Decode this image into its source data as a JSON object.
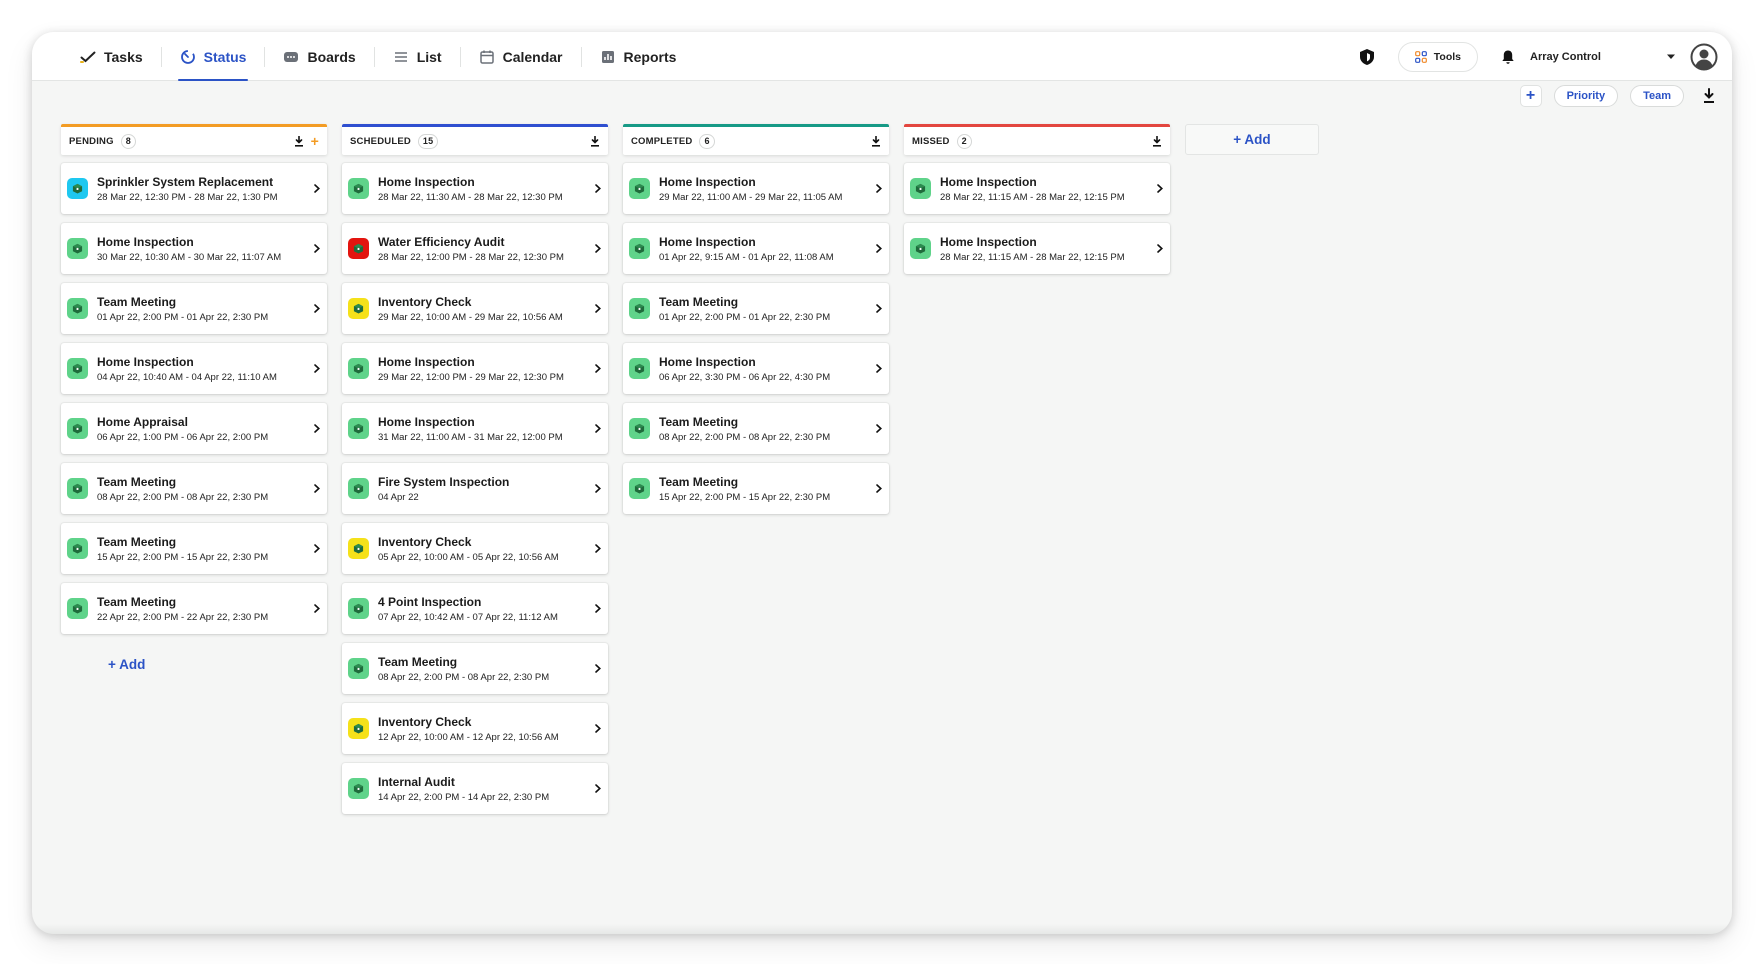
{
  "nav": {
    "tabs": [
      {
        "label": "Tasks",
        "icon": "check-icon"
      },
      {
        "label": "Status",
        "icon": "status-icon",
        "active": true
      },
      {
        "label": "Boards",
        "icon": "boards-icon"
      },
      {
        "label": "List",
        "icon": "list-icon"
      },
      {
        "label": "Calendar",
        "icon": "calendar-icon"
      },
      {
        "label": "Reports",
        "icon": "reports-icon"
      }
    ]
  },
  "toolbar": {
    "tools_label": "Tools",
    "account_name": "Array Control"
  },
  "filters": {
    "priority_label": "Priority",
    "team_label": "Team"
  },
  "colors": {
    "accent": "#2b53c6",
    "pending": "#f39c24",
    "scheduled": "#2f4fd0",
    "completed": "#179a86",
    "missed": "#e3463f",
    "icon_green": "#5fd38a",
    "icon_yellow": "#f5e11a",
    "icon_red": "#e3150f",
    "icon_cyan": "#1ec8f0"
  },
  "columns": [
    {
      "title": "PENDING",
      "count": "8",
      "color": "#f39c24",
      "has_plus": true,
      "add_label": "+ Add",
      "cards": [
        {
          "title": "Sprinkler System Replacement",
          "date": "28 Mar 22, 12:30 PM - 28 Mar 22, 1:30 PM",
          "icon_color": "#1ec8f0"
        },
        {
          "title": "Home Inspection",
          "date": "30 Mar 22, 10:30 AM - 30 Mar 22, 11:07 AM",
          "icon_color": "#5fd38a"
        },
        {
          "title": "Team Meeting",
          "date": "01 Apr 22, 2:00 PM - 01 Apr 22, 2:30 PM",
          "icon_color": "#5fd38a"
        },
        {
          "title": "Home Inspection",
          "date": "04 Apr 22, 10:40 AM - 04 Apr 22, 11:10 AM",
          "icon_color": "#5fd38a"
        },
        {
          "title": "Home Appraisal",
          "date": "06 Apr 22, 1:00 PM - 06 Apr 22, 2:00 PM",
          "icon_color": "#5fd38a"
        },
        {
          "title": "Team Meeting",
          "date": "08 Apr 22, 2:00 PM - 08 Apr 22, 2:30 PM",
          "icon_color": "#5fd38a"
        },
        {
          "title": "Team Meeting",
          "date": "15 Apr 22, 2:00 PM - 15 Apr 22, 2:30 PM",
          "icon_color": "#5fd38a"
        },
        {
          "title": "Team Meeting",
          "date": "22 Apr 22, 2:00 PM - 22 Apr 22, 2:30 PM",
          "icon_color": "#5fd38a"
        }
      ]
    },
    {
      "title": "SCHEDULED",
      "count": "15",
      "color": "#2f4fd0",
      "has_plus": false,
      "cards": [
        {
          "title": "Home Inspection",
          "date": "28 Mar 22, 11:30 AM - 28 Mar 22, 12:30 PM",
          "icon_color": "#5fd38a"
        },
        {
          "title": "Water Efficiency Audit",
          "date": "28 Mar 22, 12:00 PM - 28 Mar 22, 12:30 PM",
          "icon_color": "#e3150f"
        },
        {
          "title": "Inventory Check",
          "date": "29 Mar 22, 10:00 AM - 29 Mar 22, 10:56 AM",
          "icon_color": "#f5e11a"
        },
        {
          "title": "Home Inspection",
          "date": "29 Mar 22, 12:00 PM - 29 Mar 22, 12:30 PM",
          "icon_color": "#5fd38a"
        },
        {
          "title": "Home Inspection",
          "date": "31 Mar 22, 11:00 AM - 31 Mar 22, 12:00 PM",
          "icon_color": "#5fd38a"
        },
        {
          "title": "Fire System Inspection",
          "date": "04 Apr 22",
          "icon_color": "#5fd38a"
        },
        {
          "title": "Inventory Check",
          "date": "05 Apr 22, 10:00 AM - 05 Apr 22, 10:56 AM",
          "icon_color": "#f5e11a"
        },
        {
          "title": "4 Point Inspection",
          "date": "07 Apr 22, 10:42 AM - 07 Apr 22, 11:12 AM",
          "icon_color": "#5fd38a"
        },
        {
          "title": "Team Meeting",
          "date": "08 Apr 22, 2:00 PM - 08 Apr 22, 2:30 PM",
          "icon_color": "#5fd38a"
        },
        {
          "title": "Inventory Check",
          "date": "12 Apr 22, 10:00 AM - 12 Apr 22, 10:56 AM",
          "icon_color": "#f5e11a"
        },
        {
          "title": "Internal Audit",
          "date": "14 Apr 22, 2:00 PM - 14 Apr 22, 2:30 PM",
          "icon_color": "#5fd38a"
        }
      ]
    },
    {
      "title": "COMPLETED",
      "count": "6",
      "color": "#179a86",
      "has_plus": false,
      "cards": [
        {
          "title": "Home Inspection",
          "date": "29 Mar 22, 11:00 AM - 29 Mar 22, 11:05 AM",
          "icon_color": "#5fd38a"
        },
        {
          "title": "Home Inspection",
          "date": "01 Apr 22, 9:15 AM - 01 Apr 22, 11:08 AM",
          "icon_color": "#5fd38a"
        },
        {
          "title": "Team Meeting",
          "date": "01 Apr 22, 2:00 PM - 01 Apr 22, 2:30 PM",
          "icon_color": "#5fd38a"
        },
        {
          "title": "Home Inspection",
          "date": "06 Apr 22, 3:30 PM - 06 Apr 22, 4:30 PM",
          "icon_color": "#5fd38a"
        },
        {
          "title": "Team Meeting",
          "date": "08 Apr 22, 2:00 PM - 08 Apr 22, 2:30 PM",
          "icon_color": "#5fd38a"
        },
        {
          "title": "Team Meeting",
          "date": "15 Apr 22, 2:00 PM - 15 Apr 22, 2:30 PM",
          "icon_color": "#5fd38a"
        }
      ]
    },
    {
      "title": "MISSED",
      "count": "2",
      "color": "#e3463f",
      "has_plus": false,
      "cards": [
        {
          "title": "Home Inspection",
          "date": "28 Mar 22, 11:15 AM - 28 Mar 22, 12:15 PM",
          "icon_color": "#5fd38a"
        },
        {
          "title": "Home Inspection",
          "date": "28 Mar 22, 11:15 AM - 28 Mar 22, 12:15 PM",
          "icon_color": "#5fd38a"
        }
      ]
    }
  ],
  "add_column_label": "+ Add"
}
